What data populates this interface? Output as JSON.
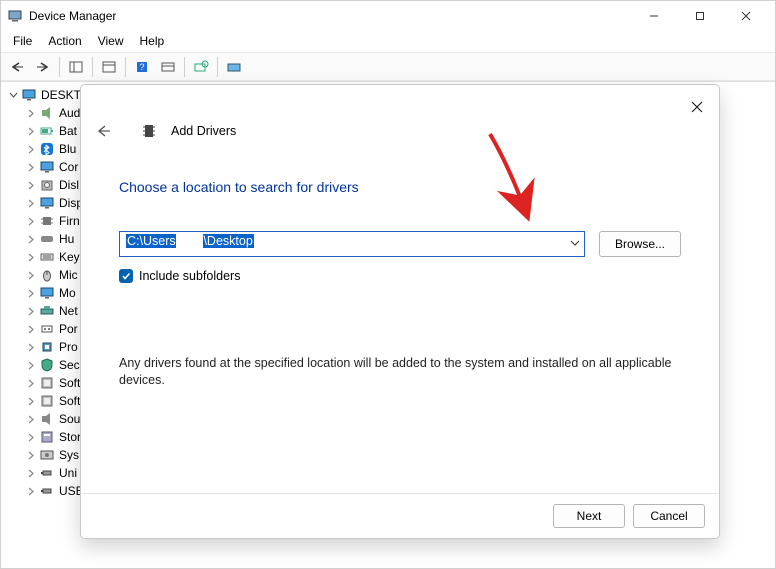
{
  "window": {
    "title": "Device Manager"
  },
  "menu": {
    "file": "File",
    "action": "Action",
    "view": "View",
    "help": "Help"
  },
  "tree": {
    "root": "DESKTO",
    "items": [
      {
        "label": "Aud",
        "icon": "speaker"
      },
      {
        "label": "Bat",
        "icon": "battery"
      },
      {
        "label": "Blu",
        "icon": "bluetooth"
      },
      {
        "label": "Cor",
        "icon": "monitor"
      },
      {
        "label": "Disl",
        "icon": "disk"
      },
      {
        "label": "Disp",
        "icon": "monitor"
      },
      {
        "label": "Firn",
        "icon": "chip"
      },
      {
        "label": "Hu",
        "icon": "hid"
      },
      {
        "label": "Key",
        "icon": "keyboard"
      },
      {
        "label": "Mic",
        "icon": "mouse"
      },
      {
        "label": "Mo",
        "icon": "monitor"
      },
      {
        "label": "Net",
        "icon": "network"
      },
      {
        "label": "Por",
        "icon": "port"
      },
      {
        "label": "Pro",
        "icon": "cpu"
      },
      {
        "label": "Sec",
        "icon": "security"
      },
      {
        "label": "Soft",
        "icon": "soft"
      },
      {
        "label": "Soft",
        "icon": "soft"
      },
      {
        "label": "Sou",
        "icon": "sound"
      },
      {
        "label": "Stor",
        "icon": "storage"
      },
      {
        "label": "Sys",
        "icon": "system"
      },
      {
        "label": "Uni",
        "icon": "usb"
      },
      {
        "label": "USE",
        "icon": "usb"
      }
    ]
  },
  "dialog": {
    "title": "Add Drivers",
    "headline": "Choose a location to search for drivers",
    "path_prefix": "C:\\Users",
    "path_suffix": "\\Desktop",
    "browse": "Browse...",
    "include_subfolders": "Include subfolders",
    "info": "Any drivers found at the specified location will be added to the system and installed on all applicable devices.",
    "next": "Next",
    "cancel": "Cancel"
  },
  "annotation": {
    "color": "#d22"
  }
}
